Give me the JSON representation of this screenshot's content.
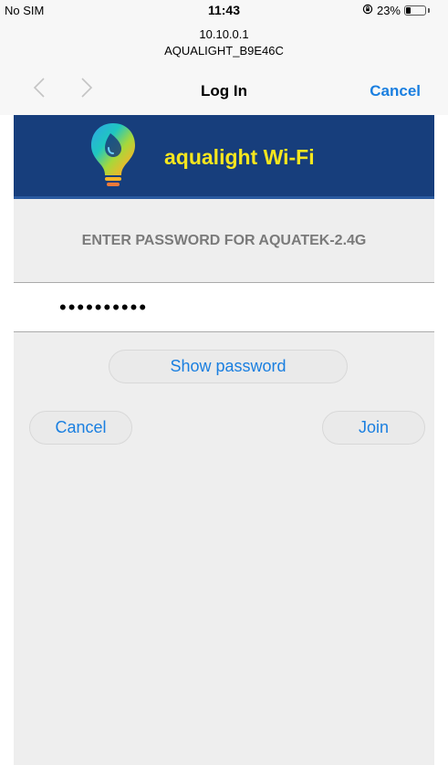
{
  "status": {
    "carrier": "No SIM",
    "time": "11:43",
    "battery_text": "23%",
    "battery_level": 0.23
  },
  "header": {
    "ip": "10.10.0.1",
    "ssid": "AQUALIGHT_B9E46C"
  },
  "nav": {
    "title": "Log In",
    "cancel_label": "Cancel"
  },
  "banner": {
    "brand": "aqualight Wi-Fi",
    "brand_color": "#f5e61e",
    "background": "#173e7c"
  },
  "form": {
    "prompt": "ENTER PASSWORD FOR AQUATEK-2.4G",
    "password_value": "••••••••••",
    "show_password_label": "Show password",
    "cancel_label": "Cancel",
    "join_label": "Join"
  },
  "colors": {
    "accent": "#1a7fe0"
  }
}
